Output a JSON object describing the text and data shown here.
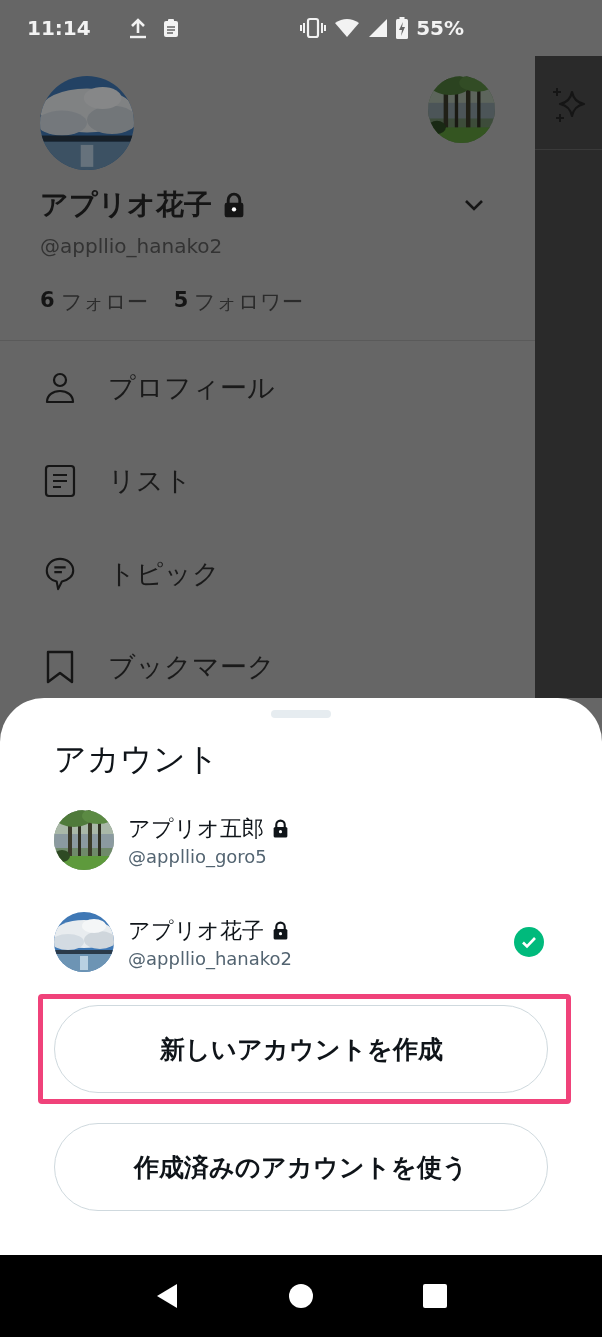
{
  "status_bar": {
    "time": "11:14",
    "battery": "55%"
  },
  "drawer": {
    "name": "アプリオ花子",
    "protected": true,
    "handle": "@appllio_hanako2",
    "following_count": "6",
    "following_label": "フォロー",
    "followers_count": "5",
    "followers_label": "フォロワー",
    "menu": [
      {
        "label": "プロフィール",
        "kind": "profile"
      },
      {
        "label": "リスト",
        "kind": "list"
      },
      {
        "label": "トピック",
        "kind": "topic"
      },
      {
        "label": "ブックマーク",
        "kind": "bookmark"
      }
    ]
  },
  "sheet": {
    "title": "アカウント",
    "accounts": [
      {
        "name": "アプリオ五郎",
        "protected": true,
        "handle": "@appllio_goro5",
        "selected": false
      },
      {
        "name": "アプリオ花子",
        "protected": true,
        "handle": "@appllio_hanako2",
        "selected": true
      }
    ],
    "buttons": [
      {
        "label": "新しいアカウントを作成",
        "highlighted": true
      },
      {
        "label": "作成済みのアカウントを使う",
        "highlighted": false
      }
    ]
  }
}
